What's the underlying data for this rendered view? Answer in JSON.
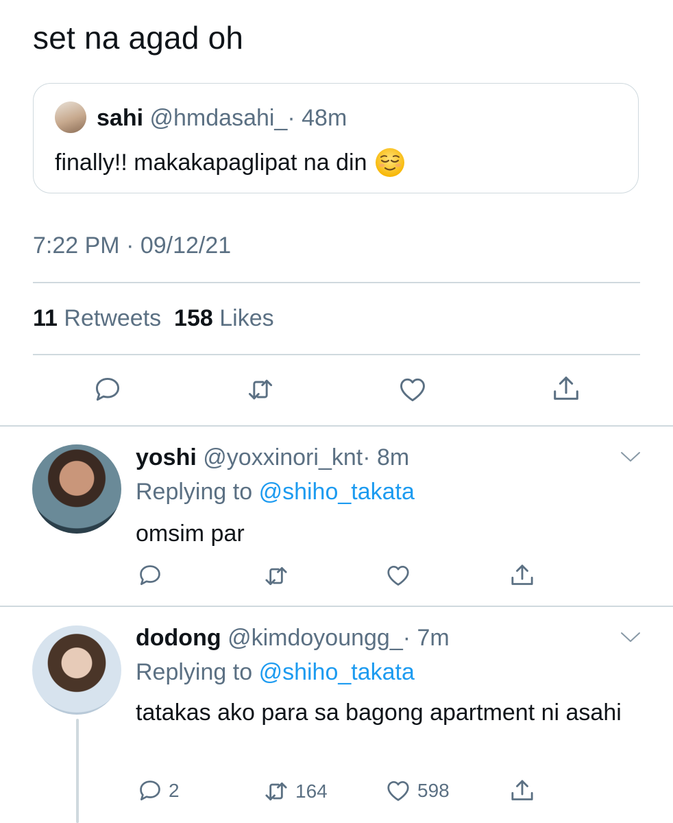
{
  "tweet": {
    "text": "set na agad oh",
    "timestamp": "7:22 PM · 09/12/21",
    "retweets": "11",
    "retweets_label": "Retweets",
    "likes": "158",
    "likes_label": "Likes"
  },
  "quoted": {
    "name": "sahi",
    "handle": "@hmdasahi_",
    "time": "· 48m",
    "text": "finally!! makakapaglipat na din"
  },
  "replies": [
    {
      "name": "yoshi",
      "handle": "@yoxxinori_knt",
      "time": "· 8m",
      "replying_prefix": "Replying to",
      "replying_to": "@shiho_takata",
      "text": "omsim par"
    },
    {
      "name": "dodong",
      "handle": "@kimdoyoungg_",
      "time": "· 7m",
      "replying_prefix": "Replying to",
      "replying_to": "@shiho_takata",
      "text": "tatakas ako para sa bagong apartment ni asahi",
      "reply_count": "2",
      "retweet_count": "164",
      "like_count": "598"
    }
  ],
  "colors": {
    "text": "#0f1419",
    "muted": "#5b7083",
    "link": "#1d9bf0",
    "divider": "#cfd9de"
  },
  "icons": [
    "reply-icon",
    "retweet-icon",
    "like-icon",
    "share-icon",
    "chevron-down-icon"
  ]
}
